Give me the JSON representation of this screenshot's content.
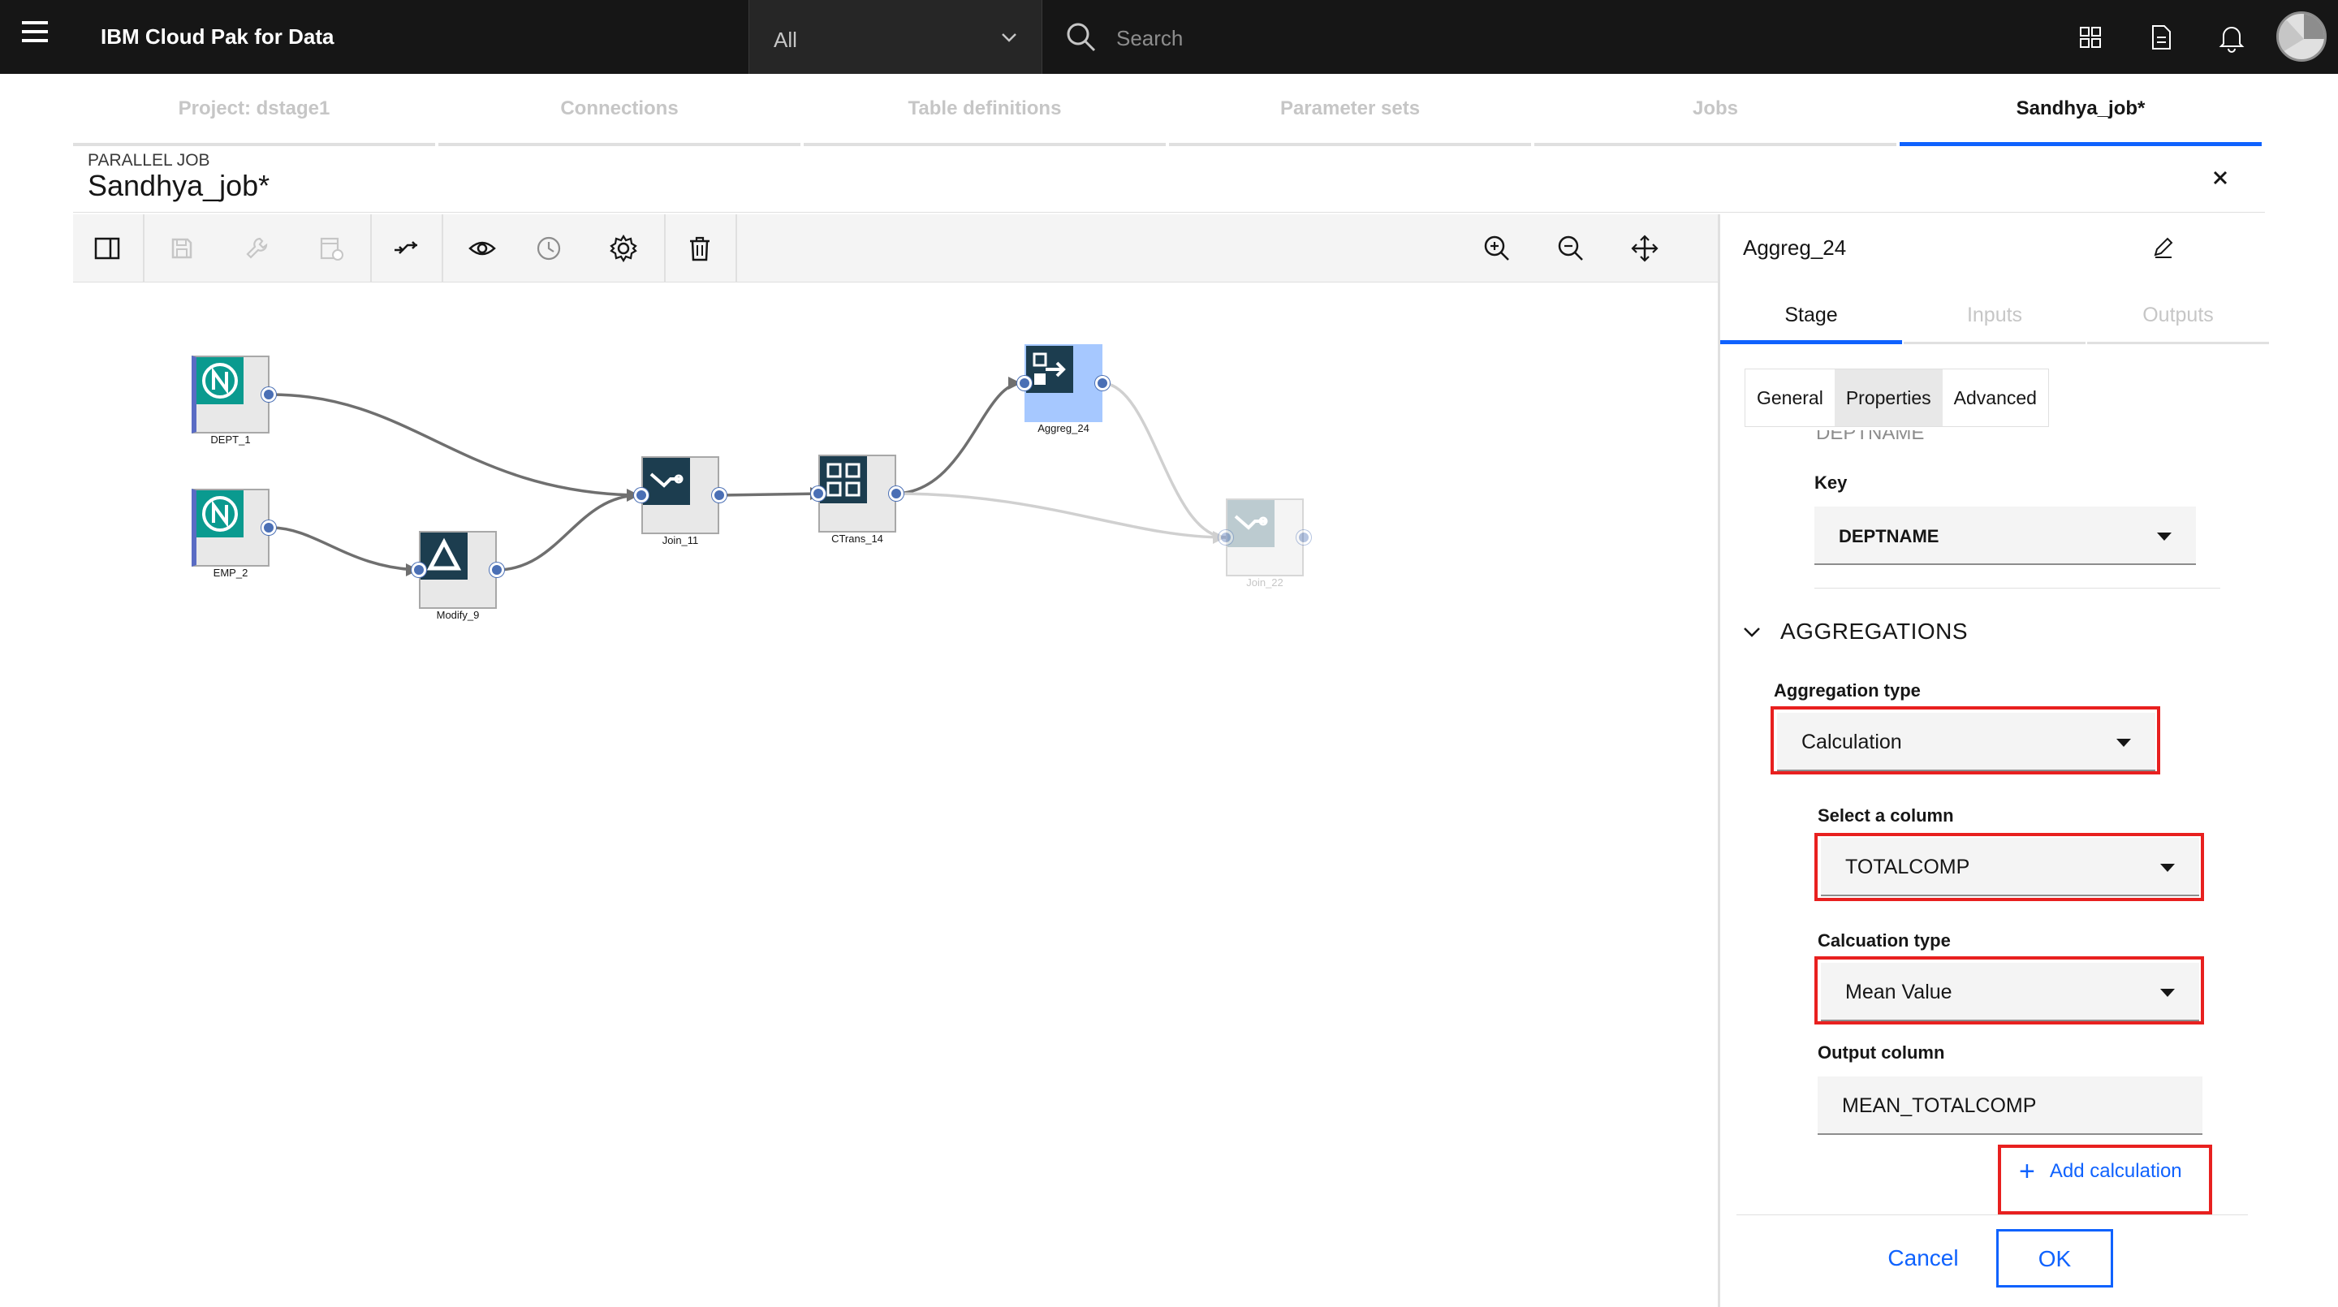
{
  "header": {
    "app_title": "IBM Cloud Pak for Data",
    "scope_value": "All",
    "search_placeholder": "Search"
  },
  "tabs": [
    {
      "label": "Project: dstage1",
      "active": false
    },
    {
      "label": "Connections",
      "active": false
    },
    {
      "label": "Table definitions",
      "active": false
    },
    {
      "label": "Parameter sets",
      "active": false
    },
    {
      "label": "Jobs",
      "active": false
    },
    {
      "label": "Sandhya_job*",
      "active": true
    }
  ],
  "job": {
    "type_label": "PARALLEL JOB",
    "name": "Sandhya_job*"
  },
  "toolbar": {
    "left_icons": [
      "panel-toggle-icon",
      "save-icon",
      "wrench-icon",
      "compile-icon",
      "arrange-icon",
      "view-icon",
      "history-icon",
      "settings-icon",
      "delete-icon"
    ],
    "right_icons": [
      "zoom-in-icon",
      "zoom-out-icon",
      "fit-icon"
    ]
  },
  "canvas": {
    "nodes": [
      {
        "id": "dept_1",
        "label": "DEPT_1",
        "kind": "source"
      },
      {
        "id": "emp_2",
        "label": "EMP_2",
        "kind": "source"
      },
      {
        "id": "modify_9",
        "label": "Modify_9",
        "kind": "modify"
      },
      {
        "id": "join_11",
        "label": "Join_11",
        "kind": "join"
      },
      {
        "id": "ctrans_14",
        "label": "CTrans_14",
        "kind": "transformer"
      },
      {
        "id": "aggreg_24",
        "label": "Aggreg_24",
        "kind": "aggregator",
        "selected": true
      },
      {
        "id": "join_22",
        "label": "Join_22",
        "kind": "join",
        "disabled": true
      }
    ],
    "links": [
      {
        "from": "DEPT_1",
        "to": "Join_11"
      },
      {
        "from": "EMP_2",
        "to": "Modify_9"
      },
      {
        "from": "Modify_9",
        "to": "Join_11"
      },
      {
        "from": "Join_11",
        "to": "CTrans_14"
      },
      {
        "from": "CTrans_14",
        "to": "Aggreg_24"
      },
      {
        "from": "CTrans_14",
        "to": "Join_22"
      },
      {
        "from": "Aggreg_24",
        "to": "Join_22"
      }
    ]
  },
  "panel": {
    "title": "Aggreg_24",
    "tabs": [
      {
        "label": "Stage",
        "active": true
      },
      {
        "label": "Inputs",
        "active": false
      },
      {
        "label": "Outputs",
        "active": false
      }
    ],
    "subtabs": [
      {
        "label": "General",
        "active": false
      },
      {
        "label": "Properties",
        "active": true
      },
      {
        "label": "Advanced",
        "active": false
      }
    ],
    "clipped_heading": "DEPTNAME",
    "key_label": "Key",
    "key_value": "DEPTNAME",
    "section_title": "AGGREGATIONS",
    "aggregation_type_label": "Aggregation type",
    "aggregation_type_value": "Calculation",
    "select_column_label": "Select a column",
    "select_column_value": "TOTALCOMP",
    "calculation_type_label": "Calcuation type",
    "calculation_type_value": "Mean Value",
    "output_column_label": "Output column",
    "output_column_value": "MEAN_TOTALCOMP",
    "add_calculation_label": "Add calculation",
    "cancel_label": "Cancel",
    "ok_label": "OK"
  },
  "colors": {
    "header_bg": "#161616",
    "accent": "#0f62fe",
    "highlight": "#e8201f",
    "node_teal": "#0a8f8f",
    "node_dark": "#1c3d4f"
  }
}
